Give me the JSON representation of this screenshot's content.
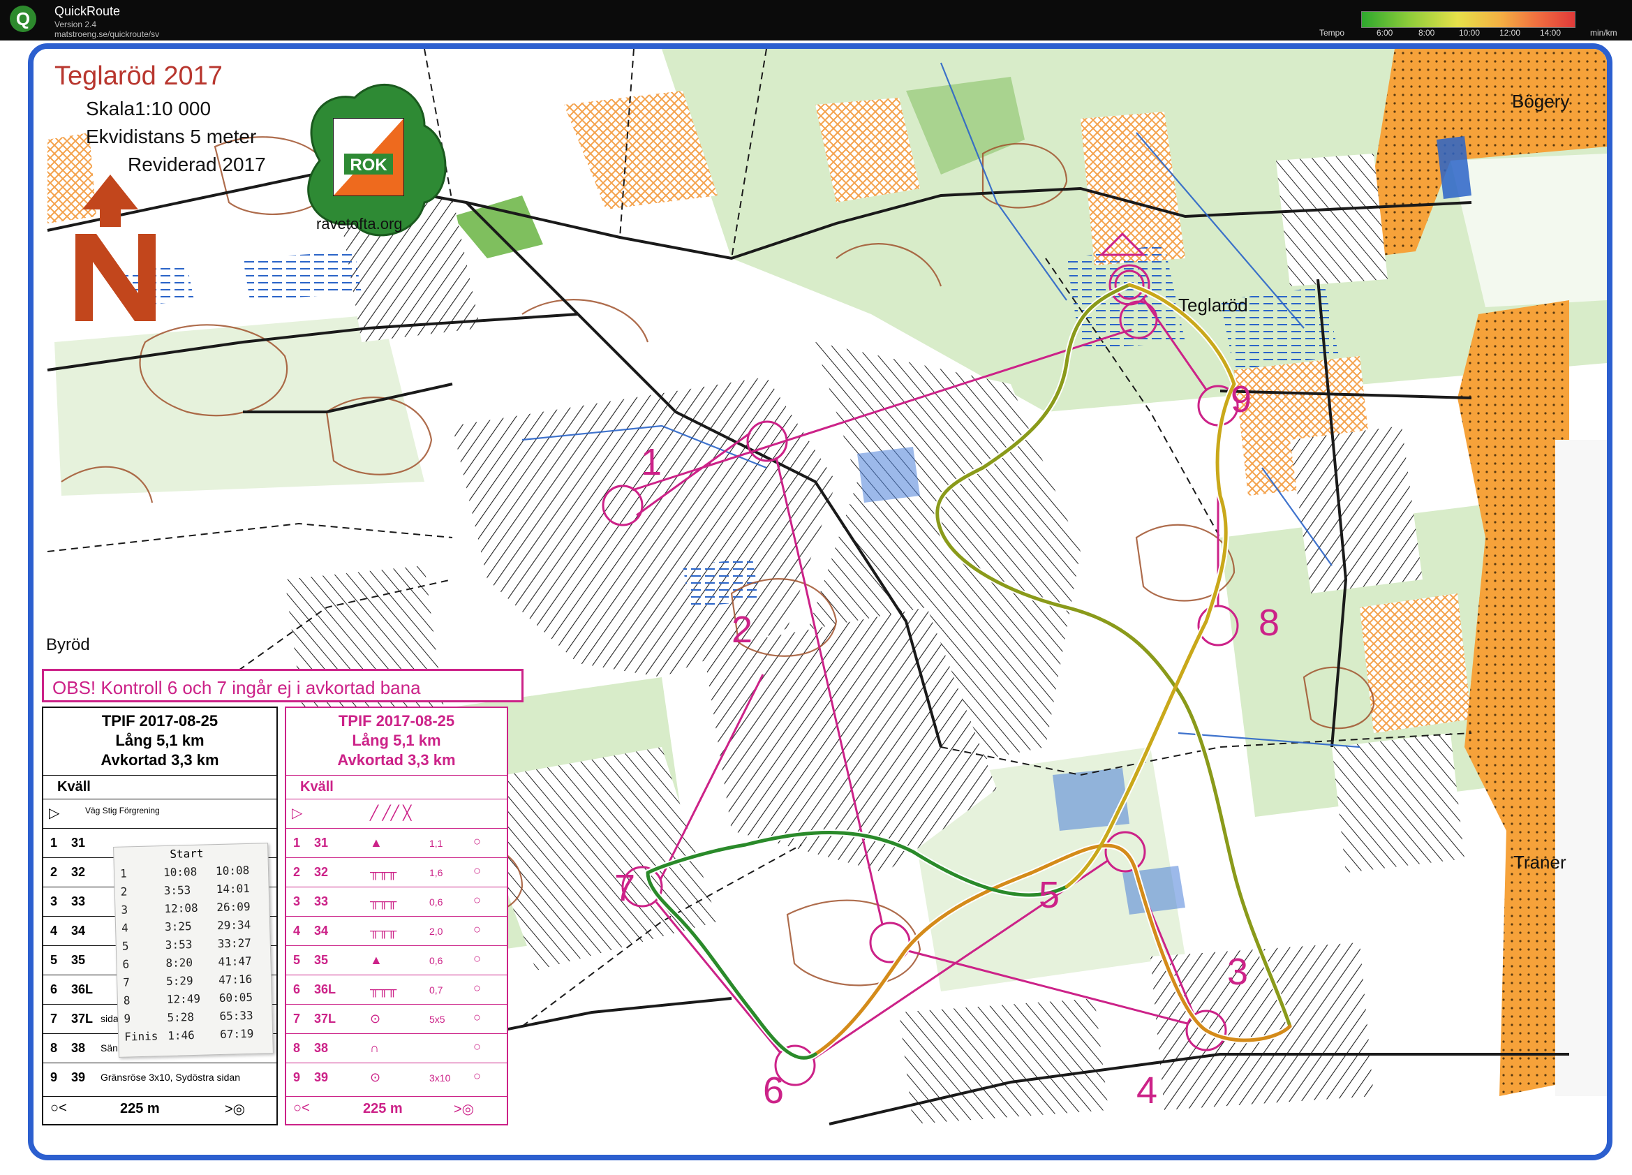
{
  "app": {
    "name": "QuickRoute",
    "version": "Version 2.4",
    "url": "matstroeng.se/quickroute/sv",
    "icon": "quickroute-q-icon"
  },
  "tempo_legend": {
    "label": "Tempo",
    "ticks": [
      "6:00",
      "8:00",
      "10:00",
      "12:00",
      "14:00"
    ],
    "unit": "min/km",
    "colors": [
      "#2ea82e",
      "#8dcc3a",
      "#e6e04a",
      "#f4b043",
      "#f07040",
      "#e03a3a"
    ]
  },
  "map_header": {
    "title": "Teglaröd 2017",
    "scale": "Skala1:10 000",
    "contour": "Ekvidistans 5 meter",
    "revised": "Reviderad 2017",
    "club_logo": "ROK",
    "website": "ravetofta.org",
    "north_icon": "north-arrow-icon"
  },
  "place_names": {
    "teglarod": "Teglaröd",
    "bogeryd": "Bögery",
    "byrod": "Byröd",
    "traner": "Traner"
  },
  "notice": "OBS! Kontroll 6 och 7 ingår ej i avkortad bana",
  "controls": [
    {
      "num": "1"
    },
    {
      "num": "2"
    },
    {
      "num": "3"
    },
    {
      "num": "4"
    },
    {
      "num": "5"
    },
    {
      "num": "6"
    },
    {
      "num": "7"
    },
    {
      "num": "8"
    },
    {
      "num": "9"
    }
  ],
  "black_card": {
    "event": "TPIF 2017-08-25",
    "long": "Lång 5,1 km",
    "short": "Avkortad 3,3 km",
    "class": "Kväll",
    "start_text": "Väg Stig Förgrening",
    "rows": [
      {
        "n": "1",
        "code": "31",
        "desc": ""
      },
      {
        "n": "2",
        "code": "32",
        "desc": ""
      },
      {
        "n": "3",
        "code": "33",
        "desc": ""
      },
      {
        "n": "4",
        "code": "34",
        "desc": ""
      },
      {
        "n": "5",
        "code": "35",
        "desc": ""
      },
      {
        "n": "6",
        "code": "36L",
        "desc": ""
      },
      {
        "n": "7",
        "code": "37L",
        "desc": "sidan"
      },
      {
        "n": "8",
        "code": "38",
        "desc": "Sänka"
      },
      {
        "n": "9",
        "code": "39",
        "desc": "Gränsröse 3x10, Sydöstra sidan"
      }
    ],
    "finish": "225 m"
  },
  "magenta_card": {
    "event": "TPIF 2017-08-25",
    "long": "Lång 5,1 km",
    "short": "Avkortad 3,3 km",
    "class": "Kväll",
    "rows": [
      {
        "n": "1",
        "code": "31",
        "sym": "▲",
        "dim": "1,1"
      },
      {
        "n": "2",
        "code": "32",
        "sym": "╥╥╥",
        "dim": "1,6"
      },
      {
        "n": "3",
        "code": "33",
        "sym": "╥╥╥",
        "dim": "0,6"
      },
      {
        "n": "4",
        "code": "34",
        "sym": "╥╥╥",
        "dim": "2,0"
      },
      {
        "n": "5",
        "code": "35",
        "sym": "▲",
        "dim": "0,6"
      },
      {
        "n": "6",
        "code": "36L",
        "sym": "╥╥╥",
        "dim": "0,7"
      },
      {
        "n": "7",
        "code": "37L",
        "sym": "⊙",
        "dim": "5x5"
      },
      {
        "n": "8",
        "code": "38",
        "sym": "∩",
        "dim": ""
      },
      {
        "n": "9",
        "code": "39",
        "sym": "⊙",
        "dim": "3x10"
      }
    ],
    "finish": "225 m"
  },
  "split_slip": {
    "header": "Start",
    "rows": [
      {
        "n": "1",
        "split": "10:08",
        "total": "10:08"
      },
      {
        "n": "2",
        "split": "3:53",
        "total": "14:01"
      },
      {
        "n": "3",
        "split": "12:08",
        "total": "26:09"
      },
      {
        "n": "4",
        "split": "3:25",
        "total": "29:34"
      },
      {
        "n": "5",
        "split": "3:53",
        "total": "33:27"
      },
      {
        "n": "6",
        "split": "8:20",
        "total": "41:47"
      },
      {
        "n": "7",
        "split": "5:29",
        "total": "47:16"
      },
      {
        "n": "8",
        "split": "12:49",
        "total": "60:05"
      },
      {
        "n": "9",
        "split": "5:28",
        "total": "65:33"
      },
      {
        "n": "Finis",
        "split": "1:46",
        "total": "67:19"
      }
    ]
  }
}
